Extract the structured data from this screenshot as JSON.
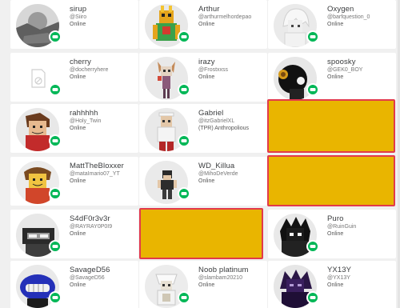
{
  "friends": [
    {
      "name": "sirup",
      "handle": "@Siiro",
      "status": "Online"
    },
    {
      "name": "Arthur",
      "handle": "@arthurmelhordepao",
      "status": "Online"
    },
    {
      "name": "Oxygen",
      "handle": "@barfquestion_0",
      "status": "Online"
    },
    {
      "name": "cherry",
      "handle": "@docherryhere",
      "status": "Online"
    },
    {
      "name": "irazy",
      "handle": "@Frostxxss",
      "status": "Online"
    },
    {
      "name": "spoosky",
      "handle": "@GEK0_BOY",
      "status": "Online"
    },
    {
      "name": "rahhhhh",
      "handle": "@Holy_Twin",
      "status": "Online"
    },
    {
      "name": "Gabriel",
      "handle": "@itzGabrielXL",
      "status": "(TPR) Anthropolious"
    },
    {
      "name": "MattTheBloxxer",
      "handle": "@mataImario07_YT",
      "status": "Online"
    },
    {
      "name": "WD_Killua",
      "handle": "@MihoDeVerde",
      "status": "Online"
    },
    {
      "name": "S4dF0r3v3r",
      "handle": "@RAYRAY0P0I9",
      "status": "Online"
    },
    {
      "name": "Puro",
      "handle": "@RuinGuin",
      "status": "Online"
    },
    {
      "name": "SavageD56",
      "handle": "@SavageD56",
      "status": "Online"
    },
    {
      "name": "Noob platinum",
      "handle": "@slambam20210",
      "status": "Online"
    },
    {
      "name": "YX13Y",
      "handle": "@YX13Y",
      "status": "Online"
    }
  ],
  "colors": {
    "presence": "#02b757",
    "redaction_fill": "#e9b500",
    "redaction_border": "#e23a4b"
  },
  "icons": {
    "presence_badge": "game-controller-icon"
  }
}
